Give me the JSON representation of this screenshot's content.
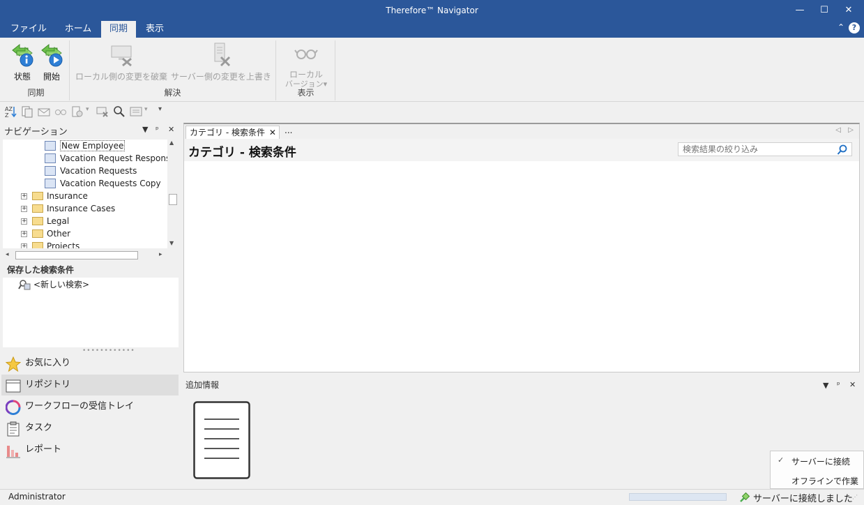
{
  "window": {
    "title": "Therefore™ Navigator"
  },
  "menu": {
    "tabs": [
      "ファイル",
      "ホーム",
      "同期",
      "表示"
    ],
    "active": "同期"
  },
  "ribbon": {
    "groups": [
      {
        "label": "同期",
        "buttons": [
          {
            "label": "状態"
          },
          {
            "label": "開始"
          }
        ]
      },
      {
        "label": "解決",
        "buttons": [
          {
            "label": "ローカル側の変更を破棄"
          },
          {
            "label": "サーバー側の変更を上書き"
          }
        ]
      },
      {
        "label": "表示",
        "buttons": [
          {
            "label_line1": "ローカル",
            "label_line2": "バージョン"
          }
        ]
      }
    ]
  },
  "navigation": {
    "title": "ナビゲーション",
    "tree": [
      {
        "label": "New Employee",
        "type": "category"
      },
      {
        "label": "Vacation Request Responses",
        "type": "category"
      },
      {
        "label": "Vacation Requests",
        "type": "category"
      },
      {
        "label": "Vacation Requests Copy",
        "type": "category"
      },
      {
        "label": "Insurance",
        "type": "folder"
      },
      {
        "label": "Insurance Cases",
        "type": "folder"
      },
      {
        "label": "Legal",
        "type": "folder"
      },
      {
        "label": "Other",
        "type": "folder"
      },
      {
        "label": "Projects",
        "type": "folder"
      }
    ],
    "saved_header": "保存した検索条件",
    "saved_item": "<新しい検索>",
    "items": [
      "お気に入り",
      "リポジトリ",
      "ワークフローの受信トレイ",
      "タスク",
      "レポート"
    ],
    "active_item": "リポジトリ"
  },
  "main": {
    "tab_label": "カテゴリ - 検索条件",
    "more": "...",
    "title": "カテゴリ - 検索条件",
    "filter_placeholder": "検索結果の絞り込み"
  },
  "addinfo": {
    "title": "追加情報"
  },
  "context_menu": {
    "items": [
      "サーバーに接続",
      "オフラインで作業"
    ],
    "checked": "サーバーに接続"
  },
  "status": {
    "user": "Administrator",
    "connection": "サーバーに接続しました"
  },
  "colors": {
    "titlebar": "#2b579a",
    "accent": "#2b579a"
  }
}
